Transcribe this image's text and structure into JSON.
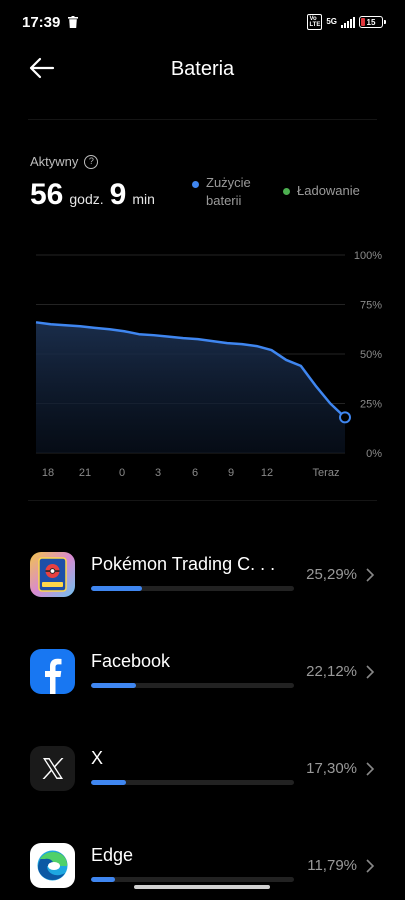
{
  "status_bar": {
    "time": "17:39",
    "vo_lte": "Vo LTE",
    "network": "5G",
    "battery": "15",
    "battery_color": "#e0363c"
  },
  "header": {
    "title": "Bateria",
    "back_icon": "arrow-left-icon"
  },
  "summary": {
    "active_label": "Aktywny",
    "hours": "56",
    "hours_unit": "godz.",
    "minutes": "9",
    "minutes_unit": "min"
  },
  "legend": {
    "usage_line1": "Zużycie",
    "usage_line2": "baterii",
    "usage_color": "#3f86f0",
    "charging": "Ładowanie",
    "charging_color": "#4caf50"
  },
  "chart_data": {
    "type": "area",
    "x_ticks": [
      "18",
      "21",
      "0",
      "3",
      "6",
      "9",
      "12",
      "Teraz"
    ],
    "y_ticks": [
      "100%",
      "75%",
      "50%",
      "25%",
      "0%"
    ],
    "ylim": [
      0,
      100
    ],
    "x": [
      0,
      1,
      2,
      3,
      4,
      5,
      6,
      7,
      8,
      9,
      10,
      11,
      12,
      13,
      14,
      15,
      16,
      17,
      18,
      19,
      20,
      21
    ],
    "values": [
      66,
      65,
      64.5,
      64,
      63.2,
      62.5,
      61.5,
      60,
      59.5,
      58.8,
      58,
      57.5,
      56.5,
      55.5,
      55,
      54,
      52,
      47,
      44,
      34,
      25,
      18
    ],
    "grid": true,
    "series_color": "#3f86f0"
  },
  "apps": [
    {
      "name": "Pokémon Trading C. . .",
      "percent": "25,29%",
      "fraction": 0.253,
      "icon": "pokemon-tcg-icon"
    },
    {
      "name": "Facebook",
      "percent": "22,12%",
      "fraction": 0.221,
      "icon": "facebook-icon"
    },
    {
      "name": "X",
      "percent": "17,30%",
      "fraction": 0.173,
      "icon": "x-icon"
    },
    {
      "name": "Edge",
      "percent": "11,79%",
      "fraction": 0.118,
      "icon": "edge-icon"
    }
  ]
}
